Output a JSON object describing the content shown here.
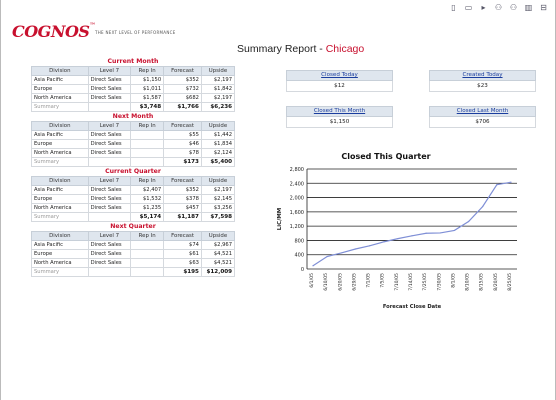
{
  "brand": {
    "logo_text": "COGNOS",
    "tagline": "THE NEXT LEVEL OF PERFORMANCE"
  },
  "toolbar": {
    "icons": [
      "page-icon",
      "window-icon",
      "play-icon",
      "people-icon",
      "people-icon",
      "chart-menu-icon",
      "export-icon"
    ]
  },
  "report": {
    "title_prefix": "Summary Report - ",
    "city": "Chicago"
  },
  "columns": [
    "Division",
    "Level 7",
    "Rep In",
    "Forecast",
    "Upside"
  ],
  "sections": [
    {
      "title": "Current Month",
      "rows": [
        [
          "Asia Pacific",
          "Direct Sales",
          "$1,150",
          "$352",
          "$2,197"
        ],
        [
          "Europe",
          "Direct Sales",
          "$1,011",
          "$732",
          "$1,842"
        ],
        [
          "North America",
          "Direct Sales",
          "$1,587",
          "$682",
          "$2,197"
        ]
      ],
      "summary": [
        "Summary",
        "",
        "$3,748",
        "$1,766",
        "$6,236"
      ]
    },
    {
      "title": "Next Month",
      "rows": [
        [
          "Asia Pacific",
          "Direct Sales",
          "",
          "$55",
          "$1,442"
        ],
        [
          "Europe",
          "Direct Sales",
          "",
          "$46",
          "$1,834"
        ],
        [
          "North America",
          "Direct Sales",
          "",
          "$78",
          "$2,124"
        ]
      ],
      "summary": [
        "Summary",
        "",
        "",
        "$173",
        "$5,400"
      ]
    },
    {
      "title": "Current Quarter",
      "rows": [
        [
          "Asia Pacific",
          "Direct Sales",
          "$2,407",
          "$352",
          "$2,197"
        ],
        [
          "Europe",
          "Direct Sales",
          "$1,532",
          "$378",
          "$2,145"
        ],
        [
          "North America",
          "Direct Sales",
          "$1,235",
          "$457",
          "$3,256"
        ]
      ],
      "summary": [
        "Summary",
        "",
        "$5,174",
        "$1,187",
        "$7,598"
      ]
    },
    {
      "title": "Next Quarter",
      "rows": [
        [
          "Asia Pacific",
          "Direct Sales",
          "",
          "$74",
          "$2,967"
        ],
        [
          "Europe",
          "Direct Sales",
          "",
          "$61",
          "$4,521"
        ],
        [
          "North America",
          "Direct Sales",
          "",
          "$63",
          "$4,521"
        ]
      ],
      "summary": [
        "Summary",
        "",
        "",
        "$195",
        "$12,009"
      ]
    }
  ],
  "kpis": {
    "closed_today": {
      "label": "Closed Today",
      "value": "$12"
    },
    "created_today": {
      "label": "Created Today",
      "value": "$23"
    },
    "closed_this_month": {
      "label": "Closed This Month",
      "value": "$1,150"
    },
    "closed_last_month": {
      "label": "Closed Last Month",
      "value": "$706"
    }
  },
  "chart_data": {
    "type": "line",
    "title": "Closed This Quarter",
    "xlabel": "Forecast Close Date",
    "ylabel": "LiC/MM",
    "ylim": [
      0,
      2800
    ],
    "yticks": [
      0,
      400,
      800,
      1200,
      1600,
      2000,
      2400,
      2800
    ],
    "yticklabels": [
      "0",
      "400",
      "800",
      "1,200",
      "1,600",
      "2,000",
      "2,400",
      "2,800"
    ],
    "grid": true,
    "x": [
      "6/1/05",
      "6/10/05",
      "6/20/05",
      "6/29/05",
      "7/1/05",
      "7/5/05",
      "7/10/05",
      "7/14/05",
      "7/25/05",
      "7/30/05",
      "8/1/05",
      "8/10/05",
      "8/15/05",
      "8/20/05",
      "8/25/05"
    ],
    "series": [
      {
        "values": [
          90,
          350,
          450,
          560,
          650,
          760,
          850,
          930,
          1000,
          1010,
          1080,
          1330,
          1750,
          2360,
          2430
        ]
      }
    ]
  }
}
